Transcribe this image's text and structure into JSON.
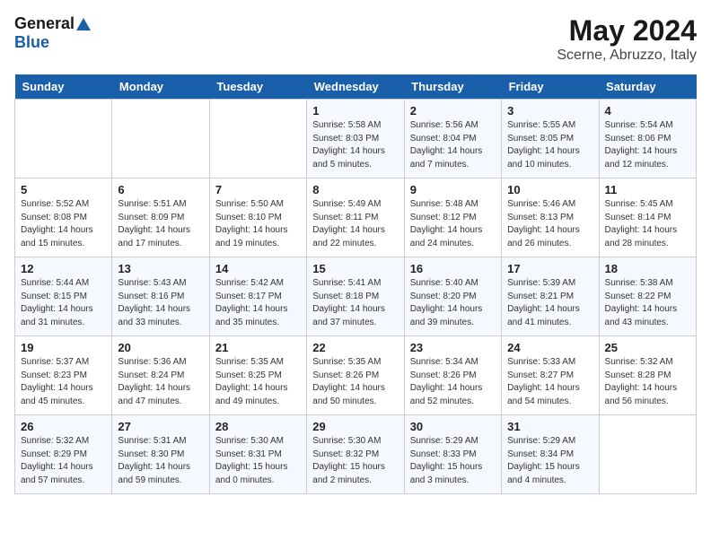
{
  "header": {
    "logo_general": "General",
    "logo_blue": "Blue",
    "month": "May 2024",
    "location": "Scerne, Abruzzo, Italy"
  },
  "weekdays": [
    "Sunday",
    "Monday",
    "Tuesday",
    "Wednesday",
    "Thursday",
    "Friday",
    "Saturday"
  ],
  "weeks": [
    [
      {
        "day": "",
        "sunrise": "",
        "sunset": "",
        "daylight": ""
      },
      {
        "day": "",
        "sunrise": "",
        "sunset": "",
        "daylight": ""
      },
      {
        "day": "",
        "sunrise": "",
        "sunset": "",
        "daylight": ""
      },
      {
        "day": "1",
        "sunrise": "Sunrise: 5:58 AM",
        "sunset": "Sunset: 8:03 PM",
        "daylight": "Daylight: 14 hours and 5 minutes."
      },
      {
        "day": "2",
        "sunrise": "Sunrise: 5:56 AM",
        "sunset": "Sunset: 8:04 PM",
        "daylight": "Daylight: 14 hours and 7 minutes."
      },
      {
        "day": "3",
        "sunrise": "Sunrise: 5:55 AM",
        "sunset": "Sunset: 8:05 PM",
        "daylight": "Daylight: 14 hours and 10 minutes."
      },
      {
        "day": "4",
        "sunrise": "Sunrise: 5:54 AM",
        "sunset": "Sunset: 8:06 PM",
        "daylight": "Daylight: 14 hours and 12 minutes."
      }
    ],
    [
      {
        "day": "5",
        "sunrise": "Sunrise: 5:52 AM",
        "sunset": "Sunset: 8:08 PM",
        "daylight": "Daylight: 14 hours and 15 minutes."
      },
      {
        "day": "6",
        "sunrise": "Sunrise: 5:51 AM",
        "sunset": "Sunset: 8:09 PM",
        "daylight": "Daylight: 14 hours and 17 minutes."
      },
      {
        "day": "7",
        "sunrise": "Sunrise: 5:50 AM",
        "sunset": "Sunset: 8:10 PM",
        "daylight": "Daylight: 14 hours and 19 minutes."
      },
      {
        "day": "8",
        "sunrise": "Sunrise: 5:49 AM",
        "sunset": "Sunset: 8:11 PM",
        "daylight": "Daylight: 14 hours and 22 minutes."
      },
      {
        "day": "9",
        "sunrise": "Sunrise: 5:48 AM",
        "sunset": "Sunset: 8:12 PM",
        "daylight": "Daylight: 14 hours and 24 minutes."
      },
      {
        "day": "10",
        "sunrise": "Sunrise: 5:46 AM",
        "sunset": "Sunset: 8:13 PM",
        "daylight": "Daylight: 14 hours and 26 minutes."
      },
      {
        "day": "11",
        "sunrise": "Sunrise: 5:45 AM",
        "sunset": "Sunset: 8:14 PM",
        "daylight": "Daylight: 14 hours and 28 minutes."
      }
    ],
    [
      {
        "day": "12",
        "sunrise": "Sunrise: 5:44 AM",
        "sunset": "Sunset: 8:15 PM",
        "daylight": "Daylight: 14 hours and 31 minutes."
      },
      {
        "day": "13",
        "sunrise": "Sunrise: 5:43 AM",
        "sunset": "Sunset: 8:16 PM",
        "daylight": "Daylight: 14 hours and 33 minutes."
      },
      {
        "day": "14",
        "sunrise": "Sunrise: 5:42 AM",
        "sunset": "Sunset: 8:17 PM",
        "daylight": "Daylight: 14 hours and 35 minutes."
      },
      {
        "day": "15",
        "sunrise": "Sunrise: 5:41 AM",
        "sunset": "Sunset: 8:18 PM",
        "daylight": "Daylight: 14 hours and 37 minutes."
      },
      {
        "day": "16",
        "sunrise": "Sunrise: 5:40 AM",
        "sunset": "Sunset: 8:20 PM",
        "daylight": "Daylight: 14 hours and 39 minutes."
      },
      {
        "day": "17",
        "sunrise": "Sunrise: 5:39 AM",
        "sunset": "Sunset: 8:21 PM",
        "daylight": "Daylight: 14 hours and 41 minutes."
      },
      {
        "day": "18",
        "sunrise": "Sunrise: 5:38 AM",
        "sunset": "Sunset: 8:22 PM",
        "daylight": "Daylight: 14 hours and 43 minutes."
      }
    ],
    [
      {
        "day": "19",
        "sunrise": "Sunrise: 5:37 AM",
        "sunset": "Sunset: 8:23 PM",
        "daylight": "Daylight: 14 hours and 45 minutes."
      },
      {
        "day": "20",
        "sunrise": "Sunrise: 5:36 AM",
        "sunset": "Sunset: 8:24 PM",
        "daylight": "Daylight: 14 hours and 47 minutes."
      },
      {
        "day": "21",
        "sunrise": "Sunrise: 5:35 AM",
        "sunset": "Sunset: 8:25 PM",
        "daylight": "Daylight: 14 hours and 49 minutes."
      },
      {
        "day": "22",
        "sunrise": "Sunrise: 5:35 AM",
        "sunset": "Sunset: 8:26 PM",
        "daylight": "Daylight: 14 hours and 50 minutes."
      },
      {
        "day": "23",
        "sunrise": "Sunrise: 5:34 AM",
        "sunset": "Sunset: 8:26 PM",
        "daylight": "Daylight: 14 hours and 52 minutes."
      },
      {
        "day": "24",
        "sunrise": "Sunrise: 5:33 AM",
        "sunset": "Sunset: 8:27 PM",
        "daylight": "Daylight: 14 hours and 54 minutes."
      },
      {
        "day": "25",
        "sunrise": "Sunrise: 5:32 AM",
        "sunset": "Sunset: 8:28 PM",
        "daylight": "Daylight: 14 hours and 56 minutes."
      }
    ],
    [
      {
        "day": "26",
        "sunrise": "Sunrise: 5:32 AM",
        "sunset": "Sunset: 8:29 PM",
        "daylight": "Daylight: 14 hours and 57 minutes."
      },
      {
        "day": "27",
        "sunrise": "Sunrise: 5:31 AM",
        "sunset": "Sunset: 8:30 PM",
        "daylight": "Daylight: 14 hours and 59 minutes."
      },
      {
        "day": "28",
        "sunrise": "Sunrise: 5:30 AM",
        "sunset": "Sunset: 8:31 PM",
        "daylight": "Daylight: 15 hours and 0 minutes."
      },
      {
        "day": "29",
        "sunrise": "Sunrise: 5:30 AM",
        "sunset": "Sunset: 8:32 PM",
        "daylight": "Daylight: 15 hours and 2 minutes."
      },
      {
        "day": "30",
        "sunrise": "Sunrise: 5:29 AM",
        "sunset": "Sunset: 8:33 PM",
        "daylight": "Daylight: 15 hours and 3 minutes."
      },
      {
        "day": "31",
        "sunrise": "Sunrise: 5:29 AM",
        "sunset": "Sunset: 8:34 PM",
        "daylight": "Daylight: 15 hours and 4 minutes."
      },
      {
        "day": "",
        "sunrise": "",
        "sunset": "",
        "daylight": ""
      }
    ]
  ]
}
